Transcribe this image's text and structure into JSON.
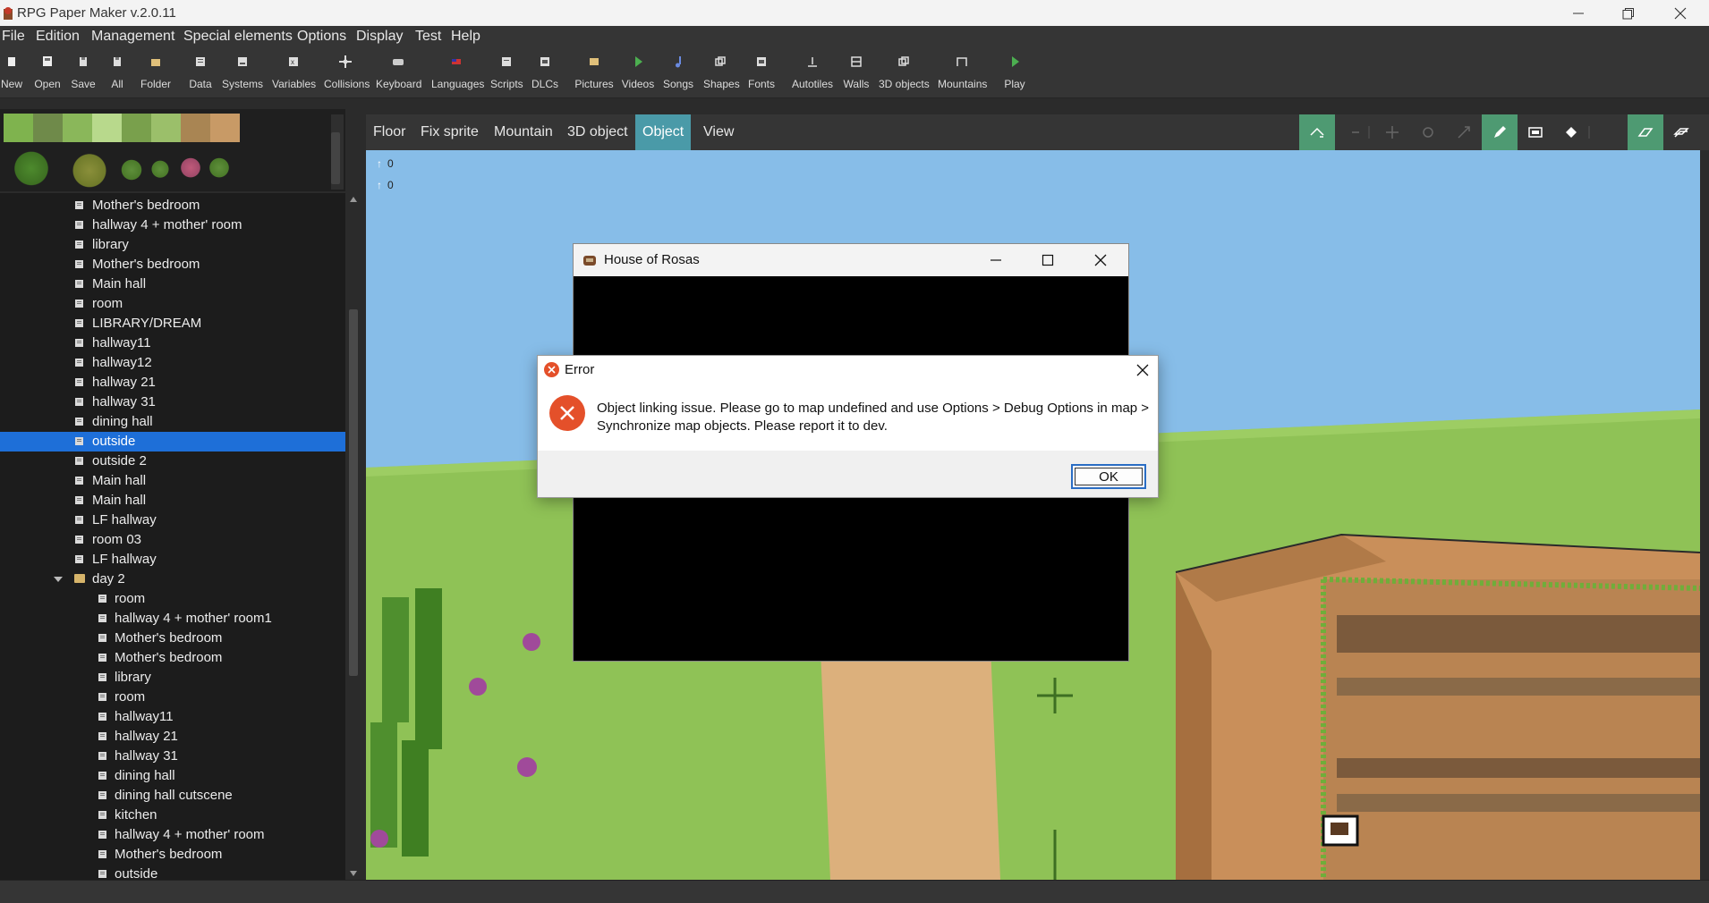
{
  "window": {
    "title": "RPG Paper Maker v.2.0.11",
    "minimize_icon": "minimize-icon",
    "restore_icon": "restore-icon",
    "close_icon": "close-icon"
  },
  "menu": [
    "File",
    "Edition",
    "Management",
    "Special elements",
    "Options",
    "Display",
    "Test",
    "Help"
  ],
  "toolbar": [
    {
      "label": "New",
      "icon": "new-file-icon"
    },
    {
      "label": "Open",
      "icon": "open-icon"
    },
    {
      "label": "Save",
      "icon": "save-icon"
    },
    {
      "label": "All",
      "icon": "save-all-icon"
    },
    {
      "label": "Folder",
      "icon": "folder-icon"
    },
    {
      "label": "Data",
      "icon": "data-icon"
    },
    {
      "label": "Systems",
      "icon": "systems-icon"
    },
    {
      "label": "Variables",
      "icon": "variables-icon"
    },
    {
      "label": "Collisions",
      "icon": "collisions-icon"
    },
    {
      "label": "Keyboard",
      "icon": "keyboard-icon"
    },
    {
      "label": "Languages",
      "icon": "languages-icon"
    },
    {
      "label": "Scripts",
      "icon": "scripts-icon"
    },
    {
      "label": "DLCs",
      "icon": "dlcs-icon"
    },
    {
      "label": "Pictures",
      "icon": "pictures-icon"
    },
    {
      "label": "Videos",
      "icon": "videos-icon"
    },
    {
      "label": "Songs",
      "icon": "songs-icon"
    },
    {
      "label": "Shapes",
      "icon": "shapes-icon"
    },
    {
      "label": "Fonts",
      "icon": "fonts-icon"
    },
    {
      "label": "Autotiles",
      "icon": "autotiles-icon"
    },
    {
      "label": "Walls",
      "icon": "walls-icon"
    },
    {
      "label": "3D objects",
      "icon": "3d-objects-icon"
    },
    {
      "label": "Mountains",
      "icon": "mountains-icon"
    },
    {
      "label": "Play",
      "icon": "play-icon"
    }
  ],
  "tree": {
    "items": [
      "Mother's bedroom",
      "hallway 4 + mother' room",
      "library",
      "Mother's bedroom",
      "Main hall",
      "room",
      "LIBRARY/DREAM",
      "hallway11",
      "hallway12",
      "hallway 21",
      "hallway 31",
      "dining hall",
      "outside",
      "outside 2",
      "Main hall",
      "Main hall",
      "LF hallway",
      "room 03",
      "LF hallway"
    ],
    "selected": "outside",
    "folder": "day 2",
    "folder_items": [
      "room",
      "hallway 4 + mother' room1",
      "Mother's bedroom",
      "Mother's bedroom",
      "library",
      "room",
      "hallway11",
      "hallway 21",
      "hallway 31",
      "dining hall",
      "dining hall cutscene",
      "kitchen",
      "hallway 4 + mother' room",
      "Mother's bedroom",
      "outside"
    ]
  },
  "map_tabs": [
    "Floor",
    "Fix sprite",
    "Mountain",
    "3D object",
    "Object",
    "View"
  ],
  "map_tabs_active": "Object",
  "coords": [
    "0",
    "0"
  ],
  "game_window": {
    "title": "House of Rosas"
  },
  "error_dialog": {
    "title": "Error",
    "message": "Object linking issue. Please go to map undefined and use Options > Debug Options in map > Synchronize map objects. Please report it to dev.",
    "ok_label": "OK"
  },
  "colors": {
    "sky": "#87bde8",
    "grass": "#8fc256",
    "path": "#dcb07c",
    "selection": "#1e6fd8",
    "active_tab": "#4a9aa8",
    "error_red": "#e4502a"
  }
}
